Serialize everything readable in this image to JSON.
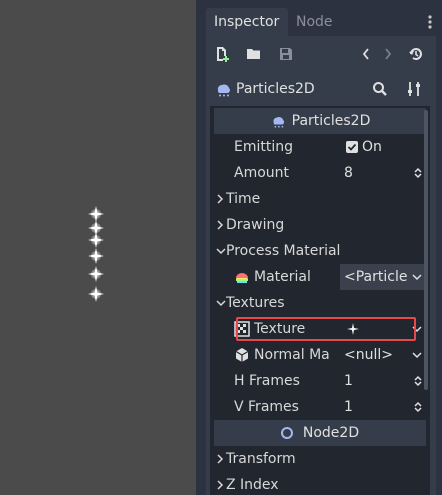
{
  "tabs": {
    "inspector": "Inspector",
    "node": "Node"
  },
  "object": {
    "name": "Particles2D"
  },
  "header": {
    "title": "Particles2D"
  },
  "properties": {
    "emitting": {
      "label": "Emitting",
      "value": "On"
    },
    "amount": {
      "label": "Amount",
      "value": "8"
    }
  },
  "sections": {
    "time": "Time",
    "drawing": "Drawing",
    "process_material": "Process Material",
    "textures": "Textures",
    "transform": "Transform",
    "z_index": "Z Index"
  },
  "material": {
    "label": "Material",
    "value": "<Particle"
  },
  "texture": {
    "label": "Texture"
  },
  "normal_map": {
    "label": "Normal Ma",
    "value": "<null>"
  },
  "h_frames": {
    "label": "H Frames",
    "value": "1"
  },
  "v_frames": {
    "label": "V Frames",
    "value": "1"
  },
  "node2d": {
    "title": "Node2D"
  },
  "colors": {
    "background": "#2c3240",
    "panel": "#363d4a",
    "list": "#21262f",
    "highlight": "#e8484c"
  },
  "icons": [
    "new-resource-icon",
    "open-icon",
    "save-icon",
    "prev-icon",
    "next-icon",
    "history-icon",
    "search-icon",
    "settings-icon",
    "particles-icon",
    "material-icon",
    "texture-icon",
    "normal-map-icon",
    "node2d-icon"
  ]
}
